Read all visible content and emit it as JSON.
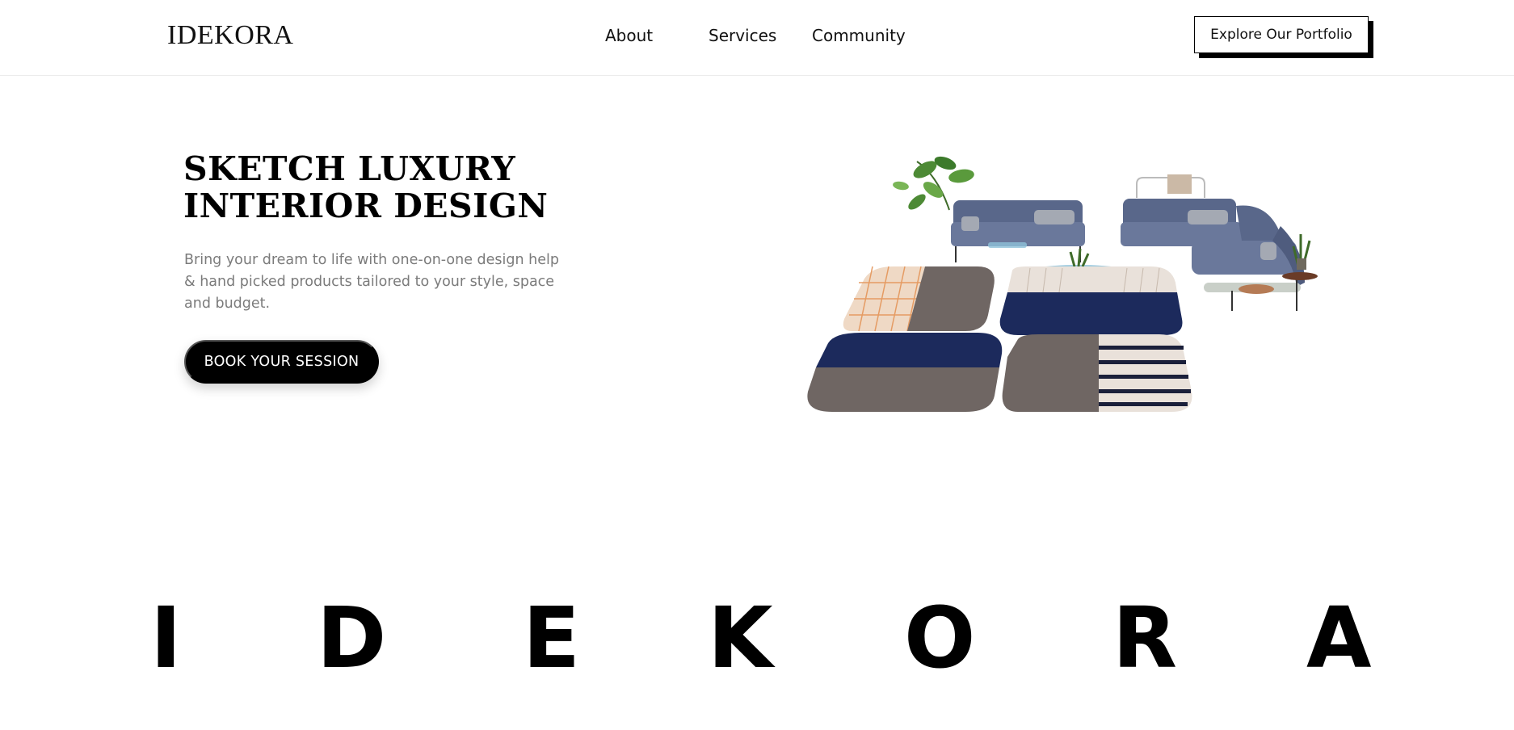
{
  "header": {
    "logo": "IDEKORA",
    "nav": [
      {
        "label": "About"
      },
      {
        "label": "Services"
      },
      {
        "label": "Community"
      }
    ],
    "cta_label": "Explore Our Portfolio"
  },
  "hero": {
    "title_line1": "SKETCH LUXURY",
    "title_line2": "INTERIOR DESIGN",
    "description": "Bring your dream to life with one-on-one design help & hand picked products tailored to your style, space and budget.",
    "button_label": "BOOK YOUR SESSION",
    "image_icon": "sofa-and-rugs-illustration"
  },
  "brand_letters": [
    "I",
    "D",
    "E",
    "K",
    "O",
    "R",
    "A"
  ],
  "colors": {
    "accent": "#000000",
    "muted_text": "#7b7b7b",
    "sofa": "#5d6b8a",
    "rug_navy": "#1c2a5c",
    "rug_taupe": "#6f6663",
    "rug_cream": "#e9e1da",
    "rug_peach": "#e9c9ad"
  }
}
